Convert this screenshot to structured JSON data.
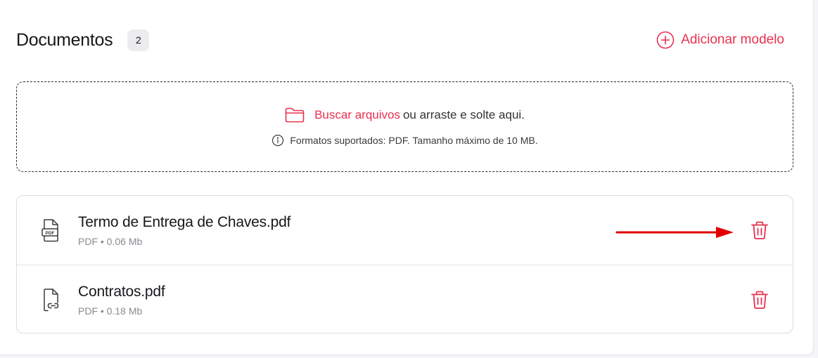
{
  "header": {
    "title": "Documentos",
    "count": "2",
    "add_label": "Adicionar modelo"
  },
  "dropzone": {
    "browse_link": "Buscar arquivos",
    "instruction": "ou arraste e solte aqui.",
    "info": "Formatos suportados: PDF. Tamanho máximo de 10 MB."
  },
  "files": [
    {
      "name": "Termo de Entrega de Chaves.pdf",
      "meta": "PDF • 0.06 Mb",
      "icon": "pdf-file-icon"
    },
    {
      "name": "Contratos.pdf",
      "meta": "PDF • 0.18 Mb",
      "icon": "linked-file-icon"
    }
  ],
  "colors": {
    "accent": "#e8314f",
    "annotation_arrow": "#e00000"
  }
}
